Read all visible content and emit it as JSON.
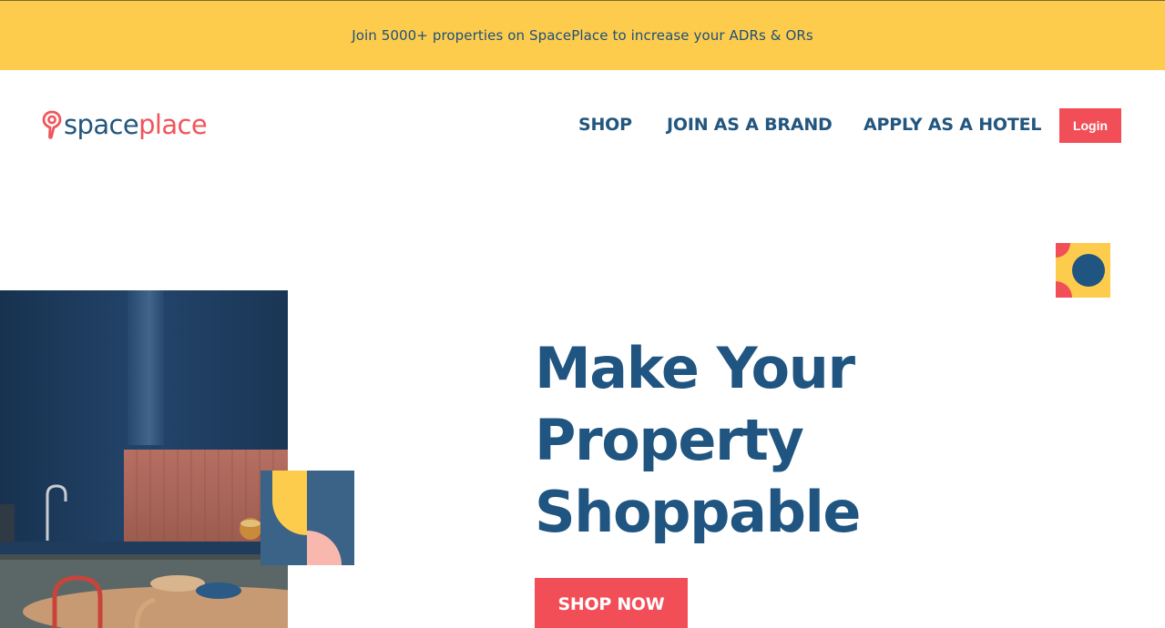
{
  "promo": {
    "text": "Join 5000+ properties on SpacePlace to increase your ADRs & ORs"
  },
  "brand": {
    "name_part1": "space",
    "name_part2": "place",
    "icon": "location-pin-icon"
  },
  "nav": {
    "items": [
      {
        "label": "SHOP"
      },
      {
        "label": "JOIN AS A BRAND"
      },
      {
        "label": "APPLY AS A HOTEL"
      }
    ],
    "login_label": "Login"
  },
  "hero": {
    "title_lines": [
      "Make Your",
      "Property",
      "Shoppable"
    ],
    "cta_label": "SHOP NOW",
    "image": "kitchen-interior-photo"
  },
  "colors": {
    "promo_bg": "#fdcc4d",
    "navy": "#1f5580",
    "coral": "#f24e58",
    "pink": "#f9b8ad",
    "slate_blue": "#3b6287"
  }
}
